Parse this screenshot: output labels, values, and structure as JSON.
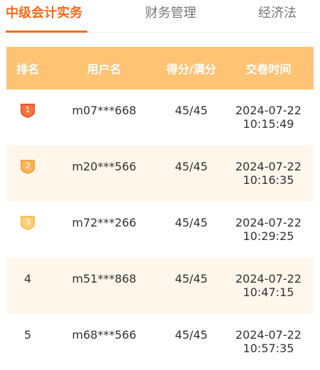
{
  "tabs": [
    {
      "label": "中级会计实务",
      "active": true
    },
    {
      "label": "财务管理",
      "active": false
    },
    {
      "label": "经济法",
      "active": false
    }
  ],
  "colors": {
    "accent": "#f16a1c",
    "header_bg": "#ffc374",
    "row_alt_bg": "#fff6ec",
    "medal_gold": "#f0582c",
    "medal_silver": "#f8a33f",
    "medal_bronze": "#fcbe5a"
  },
  "table": {
    "headers": {
      "rank": "排名",
      "user": "用户名",
      "score": "得分/满分",
      "time": "交卷时间"
    },
    "rows": [
      {
        "rank": "1",
        "rank_icon": "medal-1-icon",
        "user": "m07***668",
        "score": "45/45",
        "date": "2024-07-22",
        "time": "10:15:49"
      },
      {
        "rank": "2",
        "rank_icon": "medal-2-icon",
        "user": "m20***566",
        "score": "45/45",
        "date": "2024-07-22",
        "time": "10:16:35"
      },
      {
        "rank": "3",
        "rank_icon": "medal-3-icon",
        "user": "m72***266",
        "score": "45/45",
        "date": "2024-07-22",
        "time": "10:29:25"
      },
      {
        "rank": "4",
        "user": "m51***868",
        "score": "45/45",
        "date": "2024-07-22",
        "time": "10:47:15"
      },
      {
        "rank": "5",
        "user": "m68***566",
        "score": "45/45",
        "date": "2024-07-22",
        "time": "10:57:35"
      }
    ]
  }
}
